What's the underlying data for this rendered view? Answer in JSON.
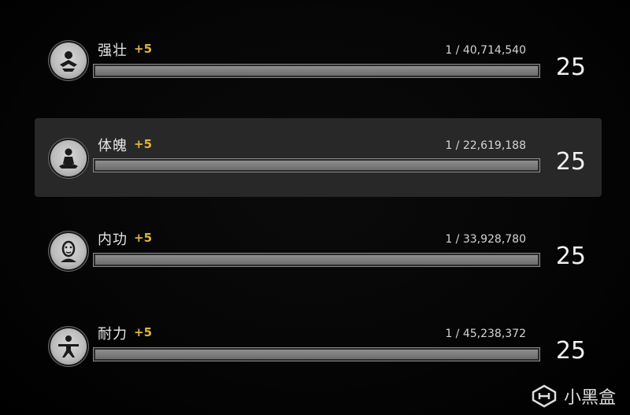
{
  "stats": [
    {
      "name": "强壮",
      "bonus": "+5",
      "progress": "1 / 40,714,540",
      "level": "25",
      "fill": 1.0,
      "icon": "strength-icon",
      "selected": false
    },
    {
      "name": "体魄",
      "bonus": "+5",
      "progress": "1 / 22,619,188",
      "level": "25",
      "fill": 1.0,
      "icon": "physique-meditation-icon",
      "selected": true
    },
    {
      "name": "内功",
      "bonus": "+5",
      "progress": "1 / 33,928,780",
      "level": "25",
      "fill": 1.0,
      "icon": "inner-power-face-icon",
      "selected": false
    },
    {
      "name": "耐力",
      "bonus": "+5",
      "progress": "1 / 45,238,372",
      "level": "25",
      "fill": 1.0,
      "icon": "endurance-stance-icon",
      "selected": false
    }
  ],
  "watermark": {
    "text": "小黑盒",
    "icon": "xiaoheihe-logo"
  },
  "colors": {
    "bonus": "#e0b43a",
    "selected_row": "#282828",
    "bar_fill": "#7d7d7d"
  }
}
